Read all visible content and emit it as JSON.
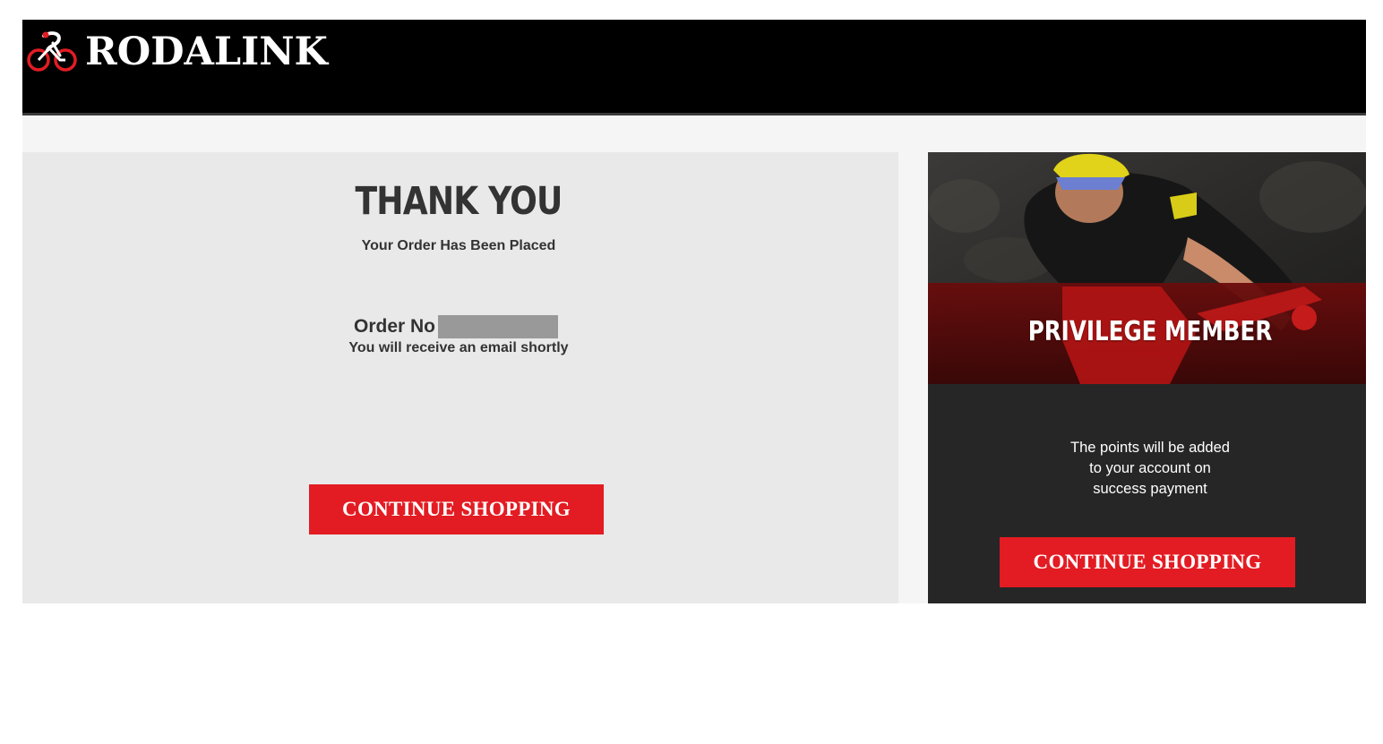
{
  "header": {
    "logo_text": "RODALINK"
  },
  "confirmation": {
    "title": "THANK YOU",
    "subtitle": "Your Order Has Been Placed",
    "order_label": "Order No",
    "email_note": "You will receive an email shortly",
    "continue_label": "CONTINUE SHOPPING"
  },
  "membership": {
    "title": "PRIVILEGE MEMBER",
    "points_text": "The points will be added\nto your account on\nsuccess payment",
    "continue_label": "CONTINUE SHOPPING"
  },
  "icons": {
    "logo": "bicycle-rider-icon"
  },
  "colors": {
    "header_bg": "#000000",
    "accent_red": "#e31c23",
    "left_panel_bg": "#e9e9e9",
    "right_panel_bg": "#262626",
    "text_dark": "#333333",
    "redacted": "#999999"
  }
}
